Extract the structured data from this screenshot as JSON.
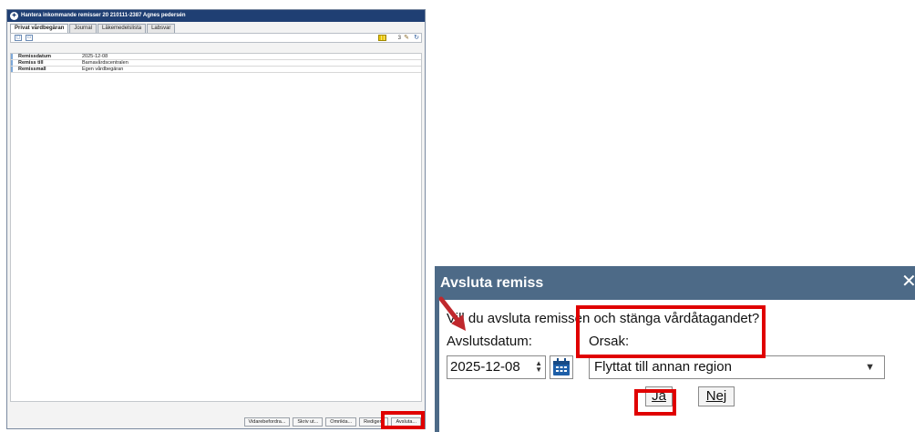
{
  "main_window": {
    "title": "Hantera inkommande remisser 20 210111-2387 Agnes pedersén",
    "tabs": [
      "Privat vårdbegäran",
      "Journal",
      "Läkemedelslista",
      "Labsvar"
    ],
    "toolbar_count": "3",
    "fields": [
      {
        "label": "Remissdatum",
        "value": "2025-12-08"
      },
      {
        "label": "Remiss till",
        "value": "Barnavårdscentralen"
      },
      {
        "label": "Remissmall",
        "value": "Egen vårdbegäran"
      }
    ],
    "footer_buttons": {
      "vidarebefordra": "Vidarebefordra...",
      "skriv_ut": "Skriv ut...",
      "omrikta": "Omrikta...",
      "redigera": "Redigera",
      "avsluta": "Avsluta..."
    }
  },
  "dialog": {
    "title": "Avsluta remiss",
    "close_glyph": "✕",
    "question": "Vill du avsluta remissen och stänga vårdåtagandet?",
    "date_label": "Avslutsdatum:",
    "date_value": "2025-12-08",
    "orsak_label": "Orsak:",
    "orsak_value": "Flyttat till annan region",
    "ja_label": "Ja",
    "nej_label": "Nej"
  },
  "icons": [
    "app-icon",
    "note-icon",
    "comment-icon",
    "bars-icon",
    "edit-icon",
    "refresh-icon",
    "calendar-icon",
    "dropdown-arrow-icon",
    "spinner-icon",
    "close-icon"
  ],
  "colors": {
    "title_bar": "#1f3f73",
    "dialog_frame": "#4d6a87",
    "highlight": "#e00000"
  }
}
